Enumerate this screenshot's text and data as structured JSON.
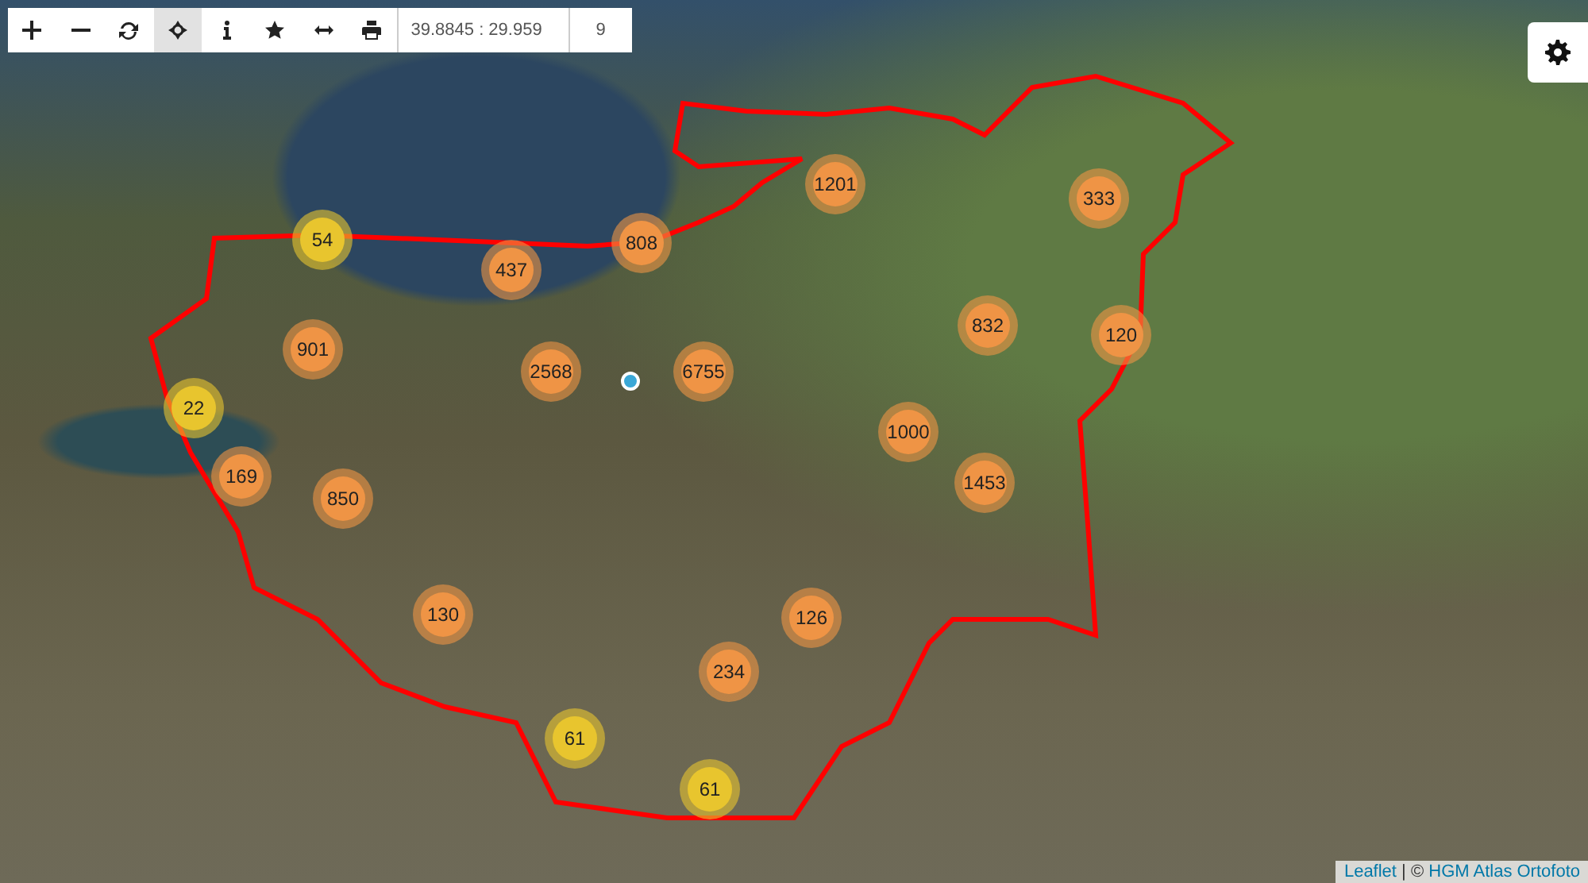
{
  "toolbar": {
    "tools": [
      {
        "kind": "plus",
        "selected": false
      },
      {
        "kind": "minus",
        "selected": false
      },
      {
        "kind": "refresh",
        "selected": false
      },
      {
        "kind": "crosshair",
        "selected": true
      },
      {
        "kind": "info",
        "selected": false
      },
      {
        "kind": "star",
        "selected": false
      },
      {
        "kind": "measure",
        "selected": false
      },
      {
        "kind": "print",
        "selected": false
      }
    ],
    "coordinates": "39.8845 : 29.959",
    "zoom": "9"
  },
  "clusters": [
    {
      "count": "54",
      "color": "#e8c52e"
    },
    {
      "count": "437",
      "color": "#ef9445"
    },
    {
      "count": "808",
      "color": "#ef9445"
    },
    {
      "count": "1201",
      "color": "#ef9445"
    },
    {
      "count": "333",
      "color": "#ef9445"
    },
    {
      "count": "901",
      "color": "#ef9445"
    },
    {
      "count": "2568",
      "color": "#ef9445"
    },
    {
      "count": "6755",
      "color": "#ef9445"
    },
    {
      "count": "832",
      "color": "#ef9445"
    },
    {
      "count": "120",
      "color": "#ef9445"
    },
    {
      "count": "22",
      "color": "#e8c52e"
    },
    {
      "count": "169",
      "color": "#ef9445"
    },
    {
      "count": "850",
      "color": "#ef9445"
    },
    {
      "count": "1000",
      "color": "#ef9445"
    },
    {
      "count": "1453",
      "color": "#ef9445"
    },
    {
      "count": "130",
      "color": "#ef9445"
    },
    {
      "count": "126",
      "color": "#ef9445"
    },
    {
      "count": "234",
      "color": "#ef9445"
    },
    {
      "count": "61",
      "color": "#e8c52e"
    },
    {
      "count": "61",
      "color": "#e8c52e"
    }
  ],
  "attribution": {
    "links": [
      "Leaflet",
      "HGM Atlas Ortofoto"
    ],
    "separator": "| ©"
  }
}
